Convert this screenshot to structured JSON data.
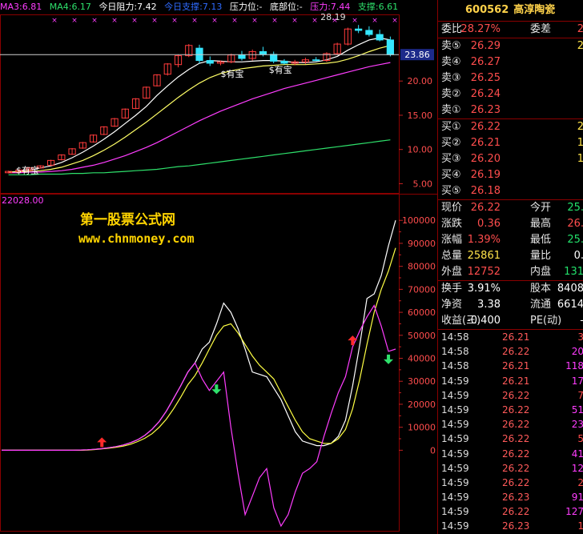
{
  "legend": {
    "ma3": "MA3:6.81",
    "ma4": "MA4:6.17",
    "resistance_today": "今日阻力:7.42",
    "support_today": "今日支撑:7.13",
    "pressure_pos": "压力位:-",
    "bottom_pos": "底部位:-",
    "pressure": "压力:7.44",
    "support": "支撑:6.61",
    "colors": {
      "ma3": "#ff3dff",
      "ma4": "#2ee06b",
      "resistance": "#ffffff",
      "support": "#2f6bff",
      "text": "#ffffff",
      "pressure": "#ff3dff",
      "support2": "#2ee06b"
    }
  },
  "header": {
    "code": "600562",
    "name": "高淳陶瓷"
  },
  "ratio": {
    "label1": "委比",
    "value1": "28.27%",
    "label2": "委差",
    "value2": "2"
  },
  "sell_orders": [
    {
      "label": "卖⑤",
      "price": "26.29",
      "vol": "2"
    },
    {
      "label": "卖④",
      "price": "26.27",
      "vol": ""
    },
    {
      "label": "卖③",
      "price": "26.25",
      "vol": ""
    },
    {
      "label": "卖②",
      "price": "26.24",
      "vol": ""
    },
    {
      "label": "卖①",
      "price": "26.23",
      "vol": ""
    }
  ],
  "buy_orders": [
    {
      "label": "买①",
      "price": "26.22",
      "vol": "2"
    },
    {
      "label": "买②",
      "price": "26.21",
      "vol": "1"
    },
    {
      "label": "买③",
      "price": "26.20",
      "vol": "1"
    },
    {
      "label": "买④",
      "price": "26.19",
      "vol": ""
    },
    {
      "label": "买⑤",
      "price": "26.18",
      "vol": ""
    }
  ],
  "quote": [
    {
      "l1": "现价",
      "v1": "26.22",
      "c1": "red",
      "l2": "今开",
      "v2": "25.",
      "c2": "green"
    },
    {
      "l1": "涨跌",
      "v1": "0.36",
      "c1": "red",
      "l2": "最高",
      "v2": "26.",
      "c2": "red"
    },
    {
      "l1": "涨幅",
      "v1": "1.39%",
      "c1": "red",
      "l2": "最低",
      "v2": "25.",
      "c2": "green"
    },
    {
      "l1": "总量",
      "v1": "25861",
      "c1": "yellow",
      "l2": "量比",
      "v2": "0.",
      "c2": "white"
    },
    {
      "l1": "外盘",
      "v1": "12752",
      "c1": "red",
      "l2": "内盘",
      "v2": "131",
      "c2": "green"
    }
  ],
  "fundamentals": [
    {
      "l1": "换手",
      "v1": "3.91%",
      "l2": "股本",
      "v2": "8408"
    },
    {
      "l1": "净资",
      "v1": "3.38",
      "l2": "流通",
      "v2": "6614"
    },
    {
      "l1": "收益(三)",
      "v1": "-0.400",
      "l2": "PE(动)",
      "v2": "-"
    }
  ],
  "ticks": [
    {
      "time": "14:58",
      "price": "26.21",
      "vol": "3",
      "c": "red"
    },
    {
      "time": "14:58",
      "price": "26.22",
      "vol": "20",
      "c": "magenta"
    },
    {
      "time": "14:58",
      "price": "26.21",
      "vol": "118",
      "c": "magenta"
    },
    {
      "time": "14:59",
      "price": "26.21",
      "vol": "17",
      "c": "magenta"
    },
    {
      "time": "14:59",
      "price": "26.22",
      "vol": "7",
      "c": "red"
    },
    {
      "time": "14:59",
      "price": "26.22",
      "vol": "51",
      "c": "magenta"
    },
    {
      "time": "14:59",
      "price": "26.22",
      "vol": "23",
      "c": "magenta"
    },
    {
      "time": "14:59",
      "price": "26.22",
      "vol": "5",
      "c": "red"
    },
    {
      "time": "14:59",
      "price": "26.22",
      "vol": "41",
      "c": "magenta"
    },
    {
      "time": "14:59",
      "price": "26.22",
      "vol": "12",
      "c": "magenta"
    },
    {
      "time": "14:59",
      "price": "26.22",
      "vol": "2",
      "c": "red"
    },
    {
      "time": "14:59",
      "price": "26.23",
      "vol": "91",
      "c": "magenta"
    },
    {
      "time": "14:59",
      "price": "26.22",
      "vol": "127",
      "c": "magenta"
    },
    {
      "time": "14:59",
      "price": "26.23",
      "vol": "1",
      "c": "red"
    }
  ],
  "watermark": {
    "line1": "第一股票公式网",
    "line2": "www.chnmoney.com"
  },
  "chart_data": [
    {
      "type": "candlestick",
      "labels": [
        "28.19",
        "$有宝",
        "$有宝",
        "$有宝",
        "23.86"
      ],
      "y_ticks": [
        5,
        10,
        15,
        20
      ],
      "y_tick_labels": [
        "5.00",
        "10.00",
        "15.00",
        "20.00"
      ],
      "ylim": [
        4,
        29.5
      ],
      "current_price": 23.86,
      "high_label": 28.19,
      "candles": [
        [
          6.6,
          6.9,
          6.5,
          6.8
        ],
        [
          6.8,
          7.1,
          6.7,
          7.0
        ],
        [
          7.0,
          7.4,
          6.9,
          7.3
        ],
        [
          7.3,
          7.7,
          7.2,
          7.6
        ],
        [
          7.7,
          8.5,
          7.6,
          8.4
        ],
        [
          8.5,
          9.3,
          8.4,
          9.2
        ],
        [
          9.3,
          10.2,
          9.2,
          10.1
        ],
        [
          10.2,
          11.1,
          10.1,
          11.0
        ],
        [
          11.1,
          12.2,
          11.0,
          12.1
        ],
        [
          12.2,
          13.4,
          12.1,
          13.3
        ],
        [
          13.4,
          14.6,
          13.3,
          14.5
        ],
        [
          14.6,
          16.0,
          14.5,
          15.9
        ],
        [
          16.0,
          17.5,
          15.9,
          17.4
        ],
        [
          17.5,
          19.2,
          17.4,
          19.1
        ],
        [
          19.3,
          21.0,
          19.2,
          20.9
        ],
        [
          21.0,
          22.6,
          20.8,
          22.5
        ],
        [
          22.4,
          23.9,
          22.0,
          23.7
        ],
        [
          23.7,
          25.4,
          23.5,
          25.2
        ],
        [
          24.8,
          25.3,
          22.6,
          23.0
        ],
        [
          23.0,
          23.6,
          22.2,
          22.6
        ],
        [
          22.6,
          23.0,
          22.3,
          22.8
        ],
        [
          22.8,
          24.0,
          22.6,
          23.8
        ],
        [
          23.8,
          24.4,
          23.0,
          23.3
        ],
        [
          23.3,
          24.6,
          23.0,
          24.3
        ],
        [
          24.3,
          25.0,
          23.6,
          23.9
        ],
        [
          23.9,
          24.3,
          22.6,
          22.9
        ],
        [
          22.9,
          23.2,
          22.4,
          22.6
        ],
        [
          22.6,
          23.1,
          22.3,
          22.8
        ],
        [
          22.8,
          23.4,
          22.5,
          23.1
        ],
        [
          23.1,
          23.5,
          22.9,
          23.0
        ],
        [
          23.0,
          24.2,
          22.8,
          24.0
        ],
        [
          24.0,
          25.6,
          23.8,
          25.4
        ],
        [
          25.4,
          27.8,
          25.2,
          27.6
        ],
        [
          27.6,
          28.19,
          27.0,
          27.4
        ],
        [
          27.4,
          28.0,
          26.5,
          26.8
        ],
        [
          26.8,
          27.5,
          25.8,
          26.0
        ],
        [
          26.0,
          26.5,
          23.6,
          23.86
        ]
      ],
      "series": [
        {
          "name": "MA3",
          "color": "#ffffff",
          "values": [
            6.7,
            6.8,
            7.0,
            7.3,
            7.6,
            8.1,
            8.8,
            9.6,
            10.5,
            11.5,
            12.6,
            13.8,
            15.0,
            16.3,
            17.9,
            19.3,
            20.6,
            21.7,
            22.6,
            23.0,
            22.9,
            22.8,
            22.8,
            22.9,
            23.0,
            23.0,
            22.9,
            22.7,
            22.7,
            22.8,
            23.1,
            23.6,
            24.5,
            25.3,
            26.0,
            26.3,
            26.0
          ]
        },
        {
          "name": "MA4",
          "color": "#ffff66",
          "values": [
            6.7,
            6.7,
            6.8,
            6.9,
            7.1,
            7.4,
            7.9,
            8.4,
            9.1,
            9.9,
            10.8,
            11.8,
            12.9,
            14.0,
            15.2,
            16.4,
            17.6,
            18.7,
            19.7,
            20.5,
            21.1,
            21.5,
            21.8,
            22.0,
            22.2,
            22.3,
            22.4,
            22.4,
            22.4,
            22.5,
            22.6,
            22.8,
            23.2,
            23.7,
            24.3,
            24.8,
            25.2
          ]
        },
        {
          "name": "MA-long",
          "color": "#ff3dff",
          "values": [
            6.6,
            6.6,
            6.7,
            6.7,
            6.8,
            6.9,
            7.1,
            7.4,
            7.7,
            8.1,
            8.6,
            9.1,
            9.7,
            10.3,
            11.0,
            11.8,
            12.6,
            13.4,
            14.2,
            14.9,
            15.6,
            16.2,
            16.8,
            17.4,
            17.9,
            18.4,
            18.9,
            19.3,
            19.7,
            20.1,
            20.5,
            20.9,
            21.3,
            21.7,
            22.1,
            22.4,
            22.7
          ]
        },
        {
          "name": "MA-slow",
          "color": "#2ee06b",
          "values": [
            6.3,
            6.3,
            6.3,
            6.4,
            6.4,
            6.4,
            6.5,
            6.5,
            6.6,
            6.6,
            6.7,
            6.8,
            6.9,
            7.0,
            7.1,
            7.3,
            7.5,
            7.6,
            7.8,
            8.0,
            8.2,
            8.4,
            8.6,
            8.8,
            9.0,
            9.2,
            9.4,
            9.6,
            9.8,
            10.0,
            10.2,
            10.4,
            10.6,
            10.8,
            11.0,
            11.2,
            11.4
          ]
        }
      ]
    },
    {
      "type": "line",
      "title": "22028.00",
      "y_ticks": [
        0,
        10000,
        20000,
        30000,
        40000,
        50000,
        60000,
        70000,
        80000,
        90000,
        100000
      ],
      "y_tick_labels": [
        "0",
        "10000",
        "20000",
        "30000",
        "40000",
        "50000",
        "60000",
        "70000",
        "80000",
        "90000",
        "100000"
      ],
      "ylim": [
        -34000,
        106000
      ],
      "series": [
        {
          "name": "white",
          "color": "#ffffff",
          "values": [
            0,
            0,
            0,
            0,
            0,
            0,
            0,
            0,
            0,
            0,
            0,
            100,
            200,
            400,
            700,
            1100,
            1600,
            2300,
            3300,
            4600,
            6500,
            9100,
            12500,
            17000,
            22500,
            28000,
            34000,
            38000,
            44000,
            47000,
            55000,
            64000,
            60000,
            53000,
            44000,
            34000,
            33000,
            32000,
            27000,
            22000,
            15000,
            8000,
            4000,
            3000,
            2000,
            2000,
            3000,
            6000,
            13000,
            28000,
            46000,
            66000,
            68000,
            76000,
            89000,
            100000
          ]
        },
        {
          "name": "yellow",
          "color": "#ffff44",
          "values": [
            0,
            0,
            0,
            0,
            0,
            0,
            0,
            0,
            0,
            0,
            0,
            0,
            100,
            300,
            600,
            900,
            1300,
            1800,
            2600,
            3800,
            5200,
            7200,
            10000,
            13500,
            18000,
            23000,
            28500,
            32500,
            38000,
            44000,
            50000,
            54000,
            55000,
            51000,
            46000,
            41000,
            37000,
            34000,
            31000,
            25000,
            19000,
            13000,
            8000,
            5000,
            4000,
            3000,
            3000,
            5000,
            9000,
            18000,
            31000,
            46000,
            60000,
            70000,
            78000,
            88000
          ]
        },
        {
          "name": "magenta",
          "color": "#ff3dff",
          "values": [
            0,
            0,
            0,
            0,
            0,
            0,
            0,
            0,
            0,
            0,
            0,
            100,
            200,
            400,
            700,
            1100,
            1600,
            2300,
            3300,
            4600,
            6500,
            9100,
            12500,
            17000,
            22500,
            28000,
            34000,
            38000,
            31000,
            26000,
            30000,
            34000,
            10000,
            -10000,
            -28000,
            -20000,
            -12000,
            -8000,
            -25000,
            -33000,
            -28000,
            -18000,
            -10000,
            -8000,
            -5000,
            6000,
            16000,
            25000,
            32000,
            45000,
            52000,
            58000,
            63000,
            54000,
            43000,
            44000
          ]
        }
      ],
      "up_arrows": [
        14,
        49
      ],
      "down_arrows": [
        30,
        54
      ]
    }
  ]
}
